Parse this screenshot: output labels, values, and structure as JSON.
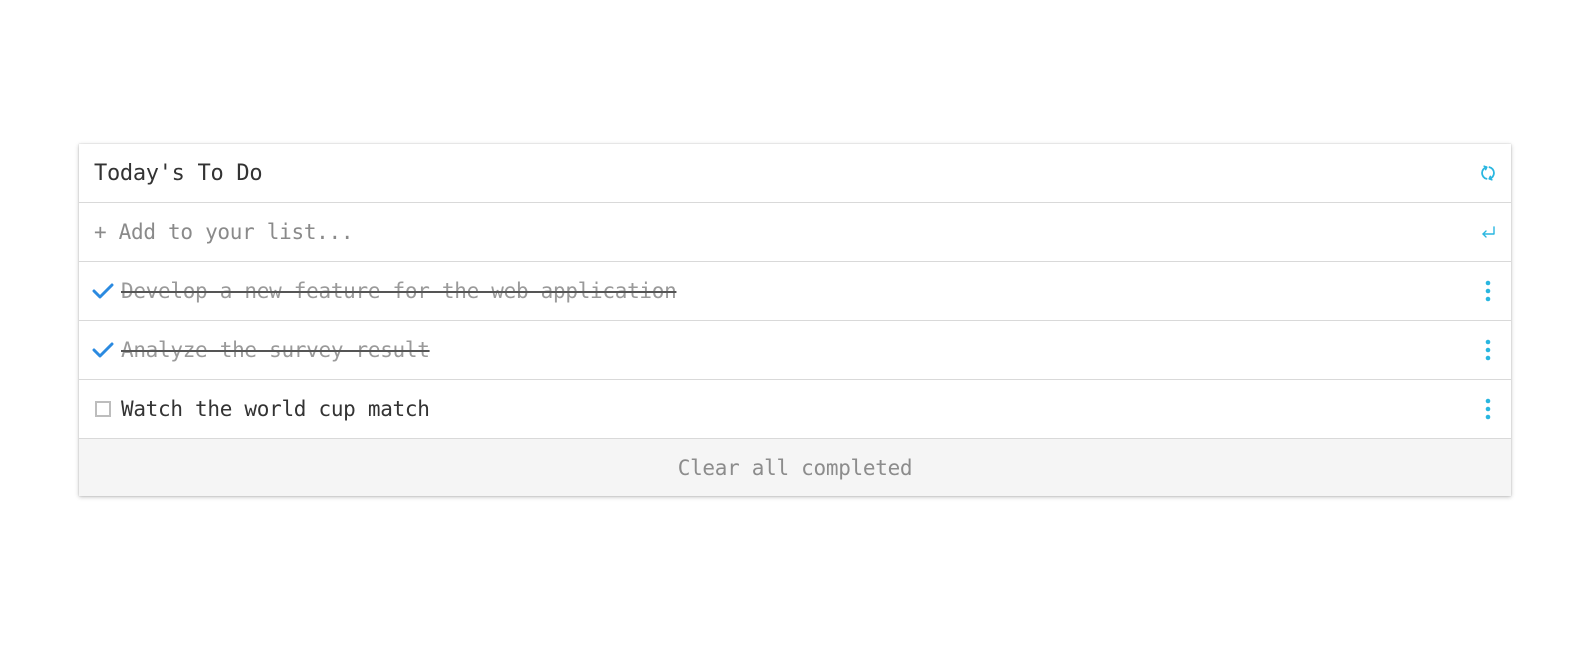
{
  "header": {
    "title": "Today's To Do",
    "refresh_icon": "refresh-icon"
  },
  "add": {
    "placeholder": "+ Add to your list...",
    "value": "",
    "enter_icon": "enter-icon"
  },
  "items": [
    {
      "text": "Develop a new feature for the web application",
      "completed": true
    },
    {
      "text": "Analyze the survey result",
      "completed": true
    },
    {
      "text": "Watch the world cup match",
      "completed": false
    }
  ],
  "footer": {
    "clear_label": "Clear all completed"
  },
  "colors": {
    "accent": "#29b6e0",
    "check": "#2b8ae0",
    "border": "#d9d9d9",
    "footer_bg": "#f5f5f5"
  }
}
